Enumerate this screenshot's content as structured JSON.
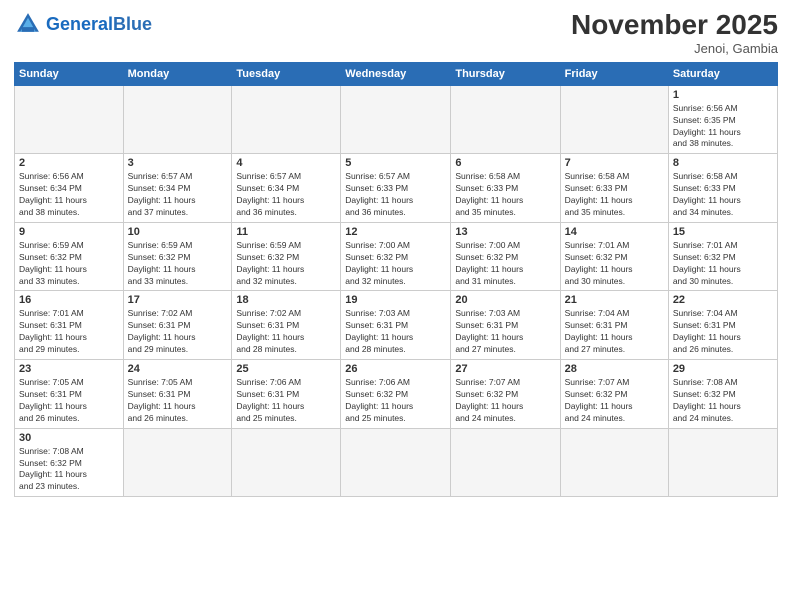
{
  "header": {
    "logo_general": "General",
    "logo_blue": "Blue",
    "month_title": "November 2025",
    "subtitle": "Jenoi, Gambia"
  },
  "weekdays": [
    "Sunday",
    "Monday",
    "Tuesday",
    "Wednesday",
    "Thursday",
    "Friday",
    "Saturday"
  ],
  "weeks": [
    [
      {
        "day": "",
        "info": ""
      },
      {
        "day": "",
        "info": ""
      },
      {
        "day": "",
        "info": ""
      },
      {
        "day": "",
        "info": ""
      },
      {
        "day": "",
        "info": ""
      },
      {
        "day": "",
        "info": ""
      },
      {
        "day": "1",
        "info": "Sunrise: 6:56 AM\nSunset: 6:35 PM\nDaylight: 11 hours\nand 38 minutes."
      }
    ],
    [
      {
        "day": "2",
        "info": "Sunrise: 6:56 AM\nSunset: 6:34 PM\nDaylight: 11 hours\nand 38 minutes."
      },
      {
        "day": "3",
        "info": "Sunrise: 6:57 AM\nSunset: 6:34 PM\nDaylight: 11 hours\nand 37 minutes."
      },
      {
        "day": "4",
        "info": "Sunrise: 6:57 AM\nSunset: 6:34 PM\nDaylight: 11 hours\nand 36 minutes."
      },
      {
        "day": "5",
        "info": "Sunrise: 6:57 AM\nSunset: 6:33 PM\nDaylight: 11 hours\nand 36 minutes."
      },
      {
        "day": "6",
        "info": "Sunrise: 6:58 AM\nSunset: 6:33 PM\nDaylight: 11 hours\nand 35 minutes."
      },
      {
        "day": "7",
        "info": "Sunrise: 6:58 AM\nSunset: 6:33 PM\nDaylight: 11 hours\nand 35 minutes."
      },
      {
        "day": "8",
        "info": "Sunrise: 6:58 AM\nSunset: 6:33 PM\nDaylight: 11 hours\nand 34 minutes."
      }
    ],
    [
      {
        "day": "9",
        "info": "Sunrise: 6:59 AM\nSunset: 6:32 PM\nDaylight: 11 hours\nand 33 minutes."
      },
      {
        "day": "10",
        "info": "Sunrise: 6:59 AM\nSunset: 6:32 PM\nDaylight: 11 hours\nand 33 minutes."
      },
      {
        "day": "11",
        "info": "Sunrise: 6:59 AM\nSunset: 6:32 PM\nDaylight: 11 hours\nand 32 minutes."
      },
      {
        "day": "12",
        "info": "Sunrise: 7:00 AM\nSunset: 6:32 PM\nDaylight: 11 hours\nand 32 minutes."
      },
      {
        "day": "13",
        "info": "Sunrise: 7:00 AM\nSunset: 6:32 PM\nDaylight: 11 hours\nand 31 minutes."
      },
      {
        "day": "14",
        "info": "Sunrise: 7:01 AM\nSunset: 6:32 PM\nDaylight: 11 hours\nand 30 minutes."
      },
      {
        "day": "15",
        "info": "Sunrise: 7:01 AM\nSunset: 6:32 PM\nDaylight: 11 hours\nand 30 minutes."
      }
    ],
    [
      {
        "day": "16",
        "info": "Sunrise: 7:01 AM\nSunset: 6:31 PM\nDaylight: 11 hours\nand 29 minutes."
      },
      {
        "day": "17",
        "info": "Sunrise: 7:02 AM\nSunset: 6:31 PM\nDaylight: 11 hours\nand 29 minutes."
      },
      {
        "day": "18",
        "info": "Sunrise: 7:02 AM\nSunset: 6:31 PM\nDaylight: 11 hours\nand 28 minutes."
      },
      {
        "day": "19",
        "info": "Sunrise: 7:03 AM\nSunset: 6:31 PM\nDaylight: 11 hours\nand 28 minutes."
      },
      {
        "day": "20",
        "info": "Sunrise: 7:03 AM\nSunset: 6:31 PM\nDaylight: 11 hours\nand 27 minutes."
      },
      {
        "day": "21",
        "info": "Sunrise: 7:04 AM\nSunset: 6:31 PM\nDaylight: 11 hours\nand 27 minutes."
      },
      {
        "day": "22",
        "info": "Sunrise: 7:04 AM\nSunset: 6:31 PM\nDaylight: 11 hours\nand 26 minutes."
      }
    ],
    [
      {
        "day": "23",
        "info": "Sunrise: 7:05 AM\nSunset: 6:31 PM\nDaylight: 11 hours\nand 26 minutes."
      },
      {
        "day": "24",
        "info": "Sunrise: 7:05 AM\nSunset: 6:31 PM\nDaylight: 11 hours\nand 26 minutes."
      },
      {
        "day": "25",
        "info": "Sunrise: 7:06 AM\nSunset: 6:31 PM\nDaylight: 11 hours\nand 25 minutes."
      },
      {
        "day": "26",
        "info": "Sunrise: 7:06 AM\nSunset: 6:32 PM\nDaylight: 11 hours\nand 25 minutes."
      },
      {
        "day": "27",
        "info": "Sunrise: 7:07 AM\nSunset: 6:32 PM\nDaylight: 11 hours\nand 24 minutes."
      },
      {
        "day": "28",
        "info": "Sunrise: 7:07 AM\nSunset: 6:32 PM\nDaylight: 11 hours\nand 24 minutes."
      },
      {
        "day": "29",
        "info": "Sunrise: 7:08 AM\nSunset: 6:32 PM\nDaylight: 11 hours\nand 24 minutes."
      }
    ],
    [
      {
        "day": "30",
        "info": "Sunrise: 7:08 AM\nSunset: 6:32 PM\nDaylight: 11 hours\nand 23 minutes."
      },
      {
        "day": "",
        "info": ""
      },
      {
        "day": "",
        "info": ""
      },
      {
        "day": "",
        "info": ""
      },
      {
        "day": "",
        "info": ""
      },
      {
        "day": "",
        "info": ""
      },
      {
        "day": "",
        "info": ""
      }
    ]
  ]
}
